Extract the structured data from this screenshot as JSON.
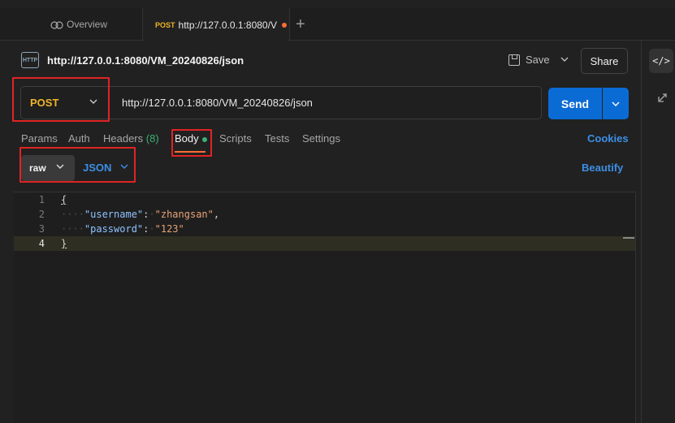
{
  "tabs": {
    "overview_label": "Overview",
    "active_method": "POST",
    "active_label": "http://127.0.0.1:8080/V",
    "add_symbol": "+"
  },
  "request": {
    "icon_text": "HTTP",
    "name": "http://127.0.0.1:8080/VM_20240826/json",
    "save_label": "Save",
    "share_label": "Share",
    "method": "POST",
    "url": "http://127.0.0.1:8080/VM_20240826/json",
    "send_label": "Send"
  },
  "subtabs": {
    "params": "Params",
    "auth": "Auth",
    "headers": "Headers",
    "headers_count": "(8)",
    "body": "Body",
    "scripts": "Scripts",
    "tests": "Tests",
    "settings": "Settings",
    "cookies": "Cookies"
  },
  "body_mode": {
    "mode": "raw",
    "language": "JSON",
    "beautify": "Beautify"
  },
  "editor": {
    "current_line": 4,
    "lines": [
      {
        "num": "1"
      },
      {
        "num": "2",
        "key": "\"username\"",
        "value": "\"zhangsan\""
      },
      {
        "num": "3",
        "key": "\"password\"",
        "value": "\"123\""
      },
      {
        "num": "4"
      }
    ]
  },
  "sidebar": {
    "code_icon_text": "</>"
  },
  "colors": {
    "accent_blue": "#0b6bd4",
    "method_post": "#f0b429",
    "annotation_red": "#e02424",
    "body_indicator": "#3bb273"
  }
}
